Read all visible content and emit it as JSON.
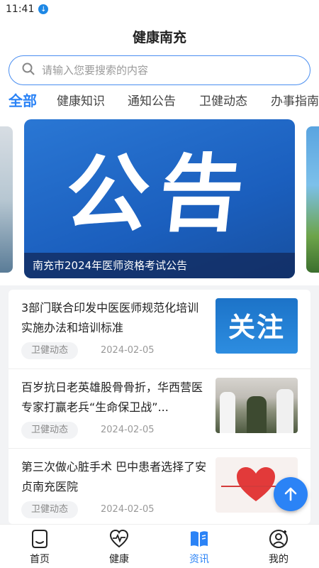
{
  "status_bar": {
    "time": "11:41"
  },
  "header": {
    "title": "健康南充"
  },
  "search": {
    "placeholder": "请输入您要搜索的内容"
  },
  "tabs": [
    {
      "label": "全部",
      "active": true
    },
    {
      "label": "健康知识",
      "active": false
    },
    {
      "label": "通知公告",
      "active": false
    },
    {
      "label": "卫健动态",
      "active": false
    },
    {
      "label": "办事指南",
      "active": false
    }
  ],
  "banner": {
    "image_text": "公告",
    "caption": "南充市2024年医师资格考试公告"
  },
  "news": [
    {
      "title": "3部门联合印发中医医师规范化培训实施办法和培训标准",
      "category": "卫健动态",
      "date": "2024-02-05",
      "thumb_text": "关注"
    },
    {
      "title": "百岁抗日老英雄股骨骨折，华西营医专家打赢老兵“生命保卫战”...",
      "category": "卫健动态",
      "date": "2024-02-05"
    },
    {
      "title": "第三次做心脏手术 巴中患者选择了安贞南充医院",
      "category": "卫健动态",
      "date": "2024-02-05"
    }
  ],
  "bottom_nav": [
    {
      "label": "首页",
      "icon": "home-icon",
      "active": false
    },
    {
      "label": "健康",
      "icon": "heart-pulse-icon",
      "active": false
    },
    {
      "label": "资讯",
      "icon": "book-icon",
      "active": true
    },
    {
      "label": "我的",
      "icon": "user-add-icon",
      "active": false
    }
  ],
  "colors": {
    "accent": "#2b83f6",
    "banner_blue": "#1b5fbe"
  }
}
